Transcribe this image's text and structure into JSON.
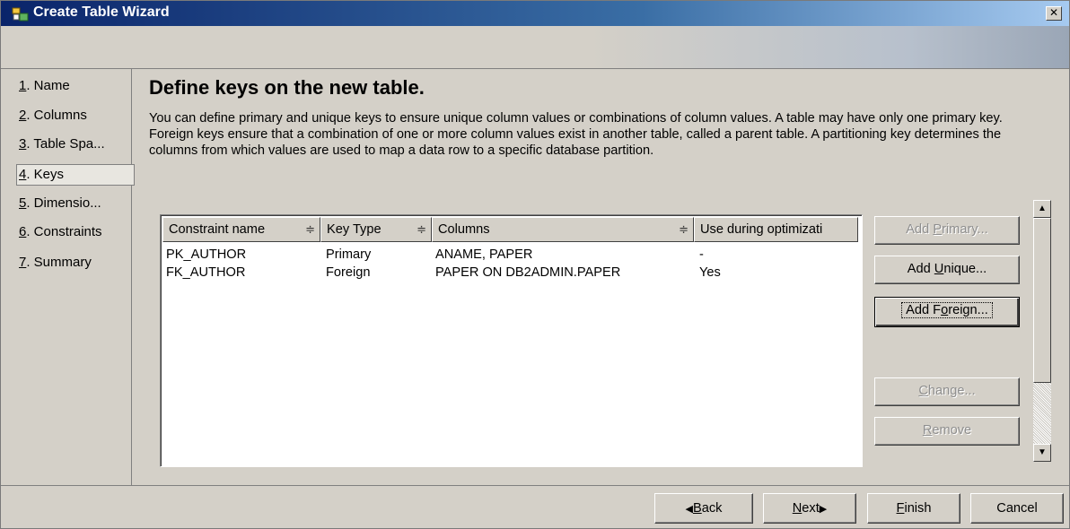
{
  "window": {
    "title": "Create Table Wizard",
    "close_glyph": "✕"
  },
  "nav": {
    "items": [
      {
        "num": "1",
        "label": ". Name"
      },
      {
        "num": "2",
        "label": ". Columns"
      },
      {
        "num": "3",
        "label": ". Table Spa..."
      },
      {
        "num": "4",
        "label": ". Keys"
      },
      {
        "num": "5",
        "label": ". Dimensio..."
      },
      {
        "num": "6",
        "label": ". Constraints"
      },
      {
        "num": "7",
        "label": ". Summary"
      }
    ],
    "active_index": 3
  },
  "main": {
    "heading": "Define keys on the new table.",
    "description": "You can define primary and unique keys to ensure unique column values or combinations of column values. A table may have only one primary key. Foreign keys ensure that a combination of one or more column values exist in another table, called a parent table. A partitioning key determines the columns from which values are used to map a data row to a specific database partition."
  },
  "table": {
    "columns": [
      "Constraint name",
      "Key Type",
      "Columns",
      "Use during optimizati"
    ],
    "sort_icon": "≑",
    "rows": [
      [
        "PK_AUTHOR",
        "Primary",
        "ANAME, PAPER",
        "-"
      ],
      [
        "FK_AUTHOR",
        "Foreign",
        "PAPER ON DB2ADMIN.PAPER",
        "Yes"
      ]
    ]
  },
  "actions": {
    "add_primary": {
      "pre": "Add ",
      "mnemonic": "P",
      "post": "rimary...",
      "enabled": false
    },
    "add_unique": {
      "pre": "Add ",
      "mnemonic": "U",
      "post": "nique...",
      "enabled": true
    },
    "add_foreign": {
      "pre": "Add F",
      "mnemonic": "o",
      "post": "reign...",
      "enabled": true
    },
    "change": {
      "pre": "",
      "mnemonic": "C",
      "post": "hange...",
      "enabled": false
    },
    "remove": {
      "pre": "",
      "mnemonic": "R",
      "post": "emove",
      "enabled": false
    }
  },
  "footer": {
    "back": {
      "arrow": "◀",
      "mnemonic": "B",
      "post": "ack"
    },
    "next": {
      "mnemonic": "N",
      "post": "ext",
      "arrow": "▶"
    },
    "finish": {
      "mnemonic": "F",
      "post": "inish"
    },
    "cancel": "Cancel"
  },
  "scrollbar": {
    "up": "▲",
    "down": "▼"
  }
}
